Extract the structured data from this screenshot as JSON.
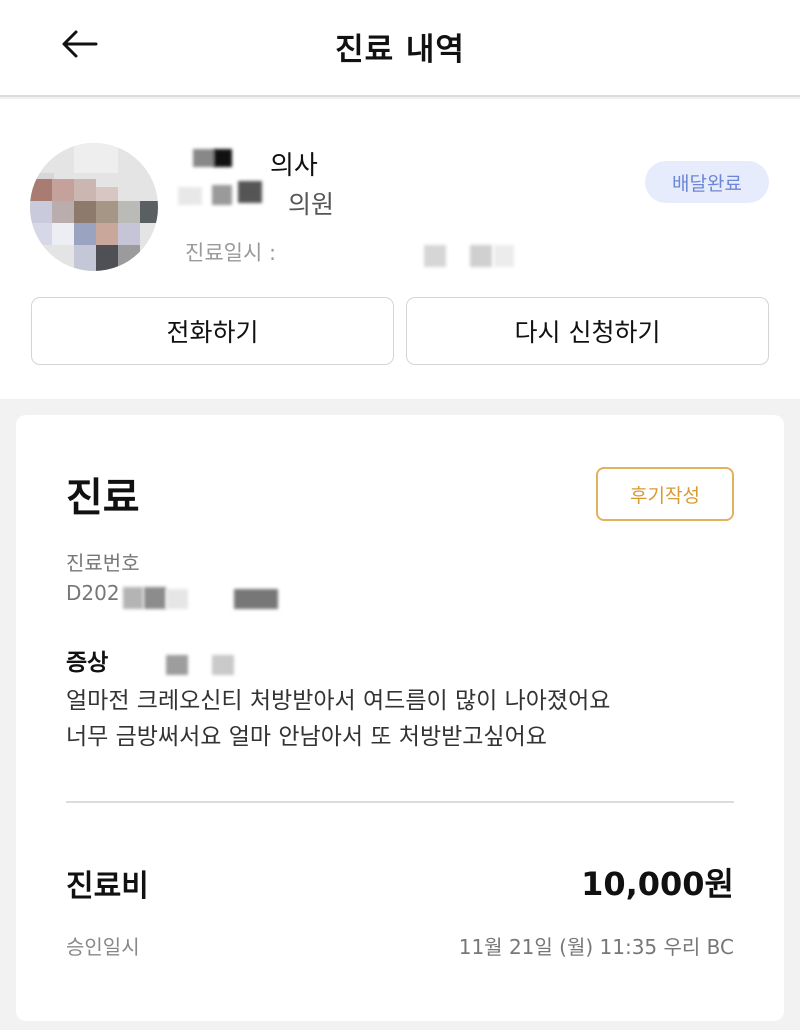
{
  "header": {
    "title": "진료 내역",
    "back_icon": "arrow-left-icon"
  },
  "doctor": {
    "title": "의사",
    "clinic": "의원",
    "date_label": "진료일시 :",
    "status": "배달완료",
    "status_color": "#6d86d8",
    "status_bg": "#e6ecfb"
  },
  "actions": {
    "call": "전화하기",
    "reapply": "다시 신청하기"
  },
  "consult": {
    "title": "진료",
    "review_button": "후기작성",
    "review_color": "#d99a34",
    "number_label": "진료번호",
    "number_prefix": "D202",
    "symptom_label": "증상",
    "symptom_lines": [
      "얼마전 크레오신티 처방받아서 여드름이 많이 나아졌어요",
      "너무 금방써서요 얼마 안남아서 또 처방받고싶어요"
    ]
  },
  "payment": {
    "fee_label": "진료비",
    "fee_amount": "10,000원",
    "approval_label": "승인일시",
    "approval_value": "11월 21일 (월) 11:35 우리 BC"
  }
}
